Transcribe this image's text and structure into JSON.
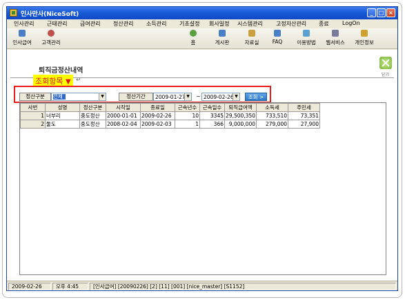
{
  "window": {
    "title": "인사만사(NiceSoft)",
    "min": "_",
    "max": "□",
    "close": "×"
  },
  "menu": [
    "인사관리",
    "근태관리",
    "급여관리",
    "정산관리",
    "소득관리",
    "기초설정",
    "회사일정",
    "시스템관리",
    "고정자산관리",
    "종료",
    "LogOn"
  ],
  "toolbar": {
    "left": [
      {
        "label": "인사급여",
        "icon": "payroll-icon",
        "color": "#4a7fc8"
      },
      {
        "label": "고객관리",
        "icon": "customer-icon",
        "color": "#c05050"
      }
    ],
    "right": [
      {
        "label": "홈",
        "icon": "home-icon",
        "color": "#58a040"
      },
      {
        "label": "게시판",
        "icon": "board-icon",
        "color": "#4a7fc8"
      },
      {
        "label": "자료실",
        "icon": "archive-icon",
        "color": "#c8a040"
      },
      {
        "label": "FAQ",
        "icon": "faq-icon",
        "color": "#4a7fc8"
      },
      {
        "label": "이용방법",
        "icon": "guide-icon",
        "color": "#5aa0d0"
      },
      {
        "label": "웹서비스",
        "icon": "web-service-icon",
        "color": "#7a7a9a"
      },
      {
        "label": "개인정보",
        "icon": "personal-info-icon",
        "color": "#d0a030"
      }
    ]
  },
  "page": {
    "title": "퇴직금정산내역",
    "close_label": "닫기"
  },
  "annotation": {
    "text": "조회항목",
    "arrow": "▼",
    "return_mark": "↵"
  },
  "filter": {
    "type_label": "정산구분",
    "type_value": "전체",
    "period_label": "정산기간",
    "date_from": "2009-01-27",
    "tilde": "~",
    "date_to": "2009-02-26",
    "query_button": "조회 >"
  },
  "grid": {
    "columns": [
      "사번",
      "성명",
      "정산구분",
      "시작일",
      "종료일",
      "근속년수",
      "근속일수",
      "퇴직급여액",
      "소득세",
      "주민세"
    ],
    "rows": [
      [
        "1",
        "너부리",
        "중도정산",
        "2000-01-01",
        "2009-02-26",
        "10",
        "3345",
        "29,500,350",
        "733,510",
        "73,351"
      ],
      [
        "2",
        "둘도",
        "중도정산",
        "2008-02-04",
        "2009-02-03",
        "1",
        "366",
        "9,000,000",
        "279,000",
        "27,900"
      ]
    ]
  },
  "status": [
    "2009-02-26",
    "오후 4:45",
    "[인사급여] [20090226] [2] [11] [001] [nice_master] [S1152]"
  ]
}
